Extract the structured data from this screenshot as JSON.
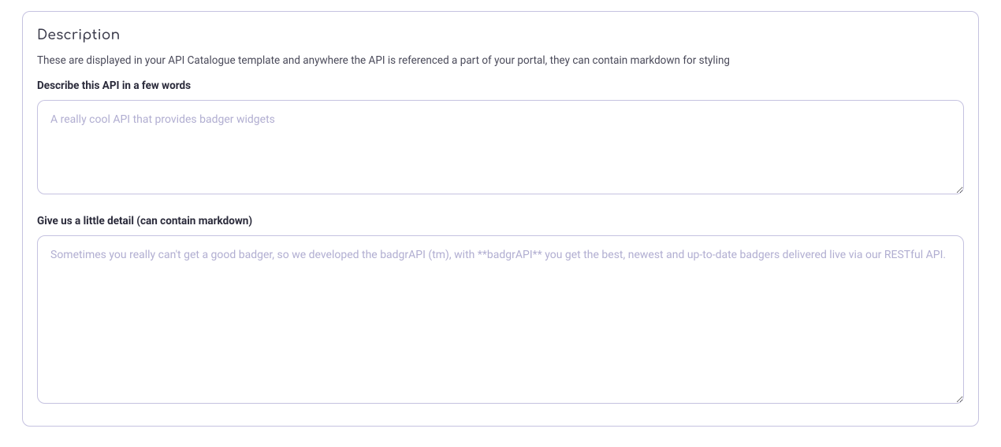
{
  "section": {
    "title": "Description",
    "subtitle": "These are displayed in your API Catalogue template and anywhere the API is referenced a part of your portal, they can contain markdown for styling",
    "short_desc": {
      "label": "Describe this API in a few words",
      "placeholder": "A really cool API that provides badger widgets",
      "value": ""
    },
    "long_desc": {
      "label": "Give us a little detail (can contain markdown)",
      "placeholder": "Sometimes you really can't get a good badger, so we developed the badgrAPI (tm), with **badgrAPI** you get the best, newest and up-to-date badgers delivered live via our RESTful API.",
      "value": ""
    }
  }
}
